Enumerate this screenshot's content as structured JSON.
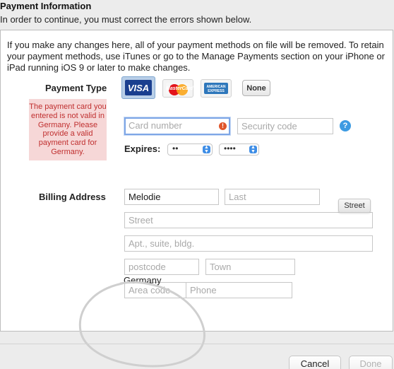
{
  "header": {
    "title": "Payment Information",
    "subtitle": "In order to continue, you must correct the errors shown below."
  },
  "intro_text": "If you make any changes here, all of your payment methods on file will be removed. To retain your payment methods, use iTunes or go to the Manage Payments section on your iPhone or iPad running iOS 9 or later to make changes.",
  "payment_type": {
    "label": "Payment Type",
    "options": [
      {
        "name": "VISA",
        "selected": true
      },
      {
        "name": "MasterCard",
        "selected": false
      },
      {
        "name": "AMERICAN EXPRESS",
        "selected": false
      },
      {
        "name": "None",
        "selected": false
      }
    ],
    "none_label": "None",
    "visa_label": "VISA",
    "mastercard_label": "MasterCard",
    "amex_label": "AMERICAN EXPRESS"
  },
  "error_message": "The payment card you entered is not valid in Germany. Please provide a valid payment card for Germany.",
  "card": {
    "number_placeholder": "Card number",
    "number_value": "",
    "security_placeholder": "Security code",
    "help_glyph": "?",
    "error_glyph": "!"
  },
  "expires": {
    "label": "Expires:",
    "month_value": "••",
    "year_value": "••••"
  },
  "billing": {
    "label": "Billing Address",
    "first_name": "Melodie",
    "last_placeholder": "Last",
    "street_placeholder": "Street",
    "apt_placeholder": "Apt., suite, bldg.",
    "postcode_placeholder": "postcode",
    "town_placeholder": "Town",
    "area_code_placeholder": "Area code",
    "phone_placeholder": "Phone",
    "country": "Germany",
    "tooltip": "Street"
  },
  "footer": {
    "cancel_label": "Cancel",
    "done_label": "Done"
  },
  "colors": {
    "error_bg": "#f6d7d7",
    "error_text": "#c03030",
    "focus_ring": "#7ea6e6",
    "accent_blue": "#3d9be2"
  },
  "icons": [
    "error-icon",
    "help-icon",
    "chevron-updown-icon"
  ]
}
